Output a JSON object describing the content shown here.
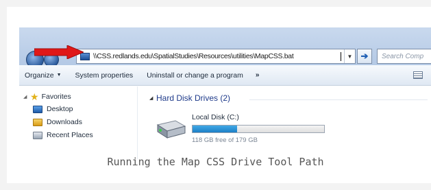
{
  "address_bar": {
    "path": "\\\\CSS.redlands.edu\\SpatialStudies\\Resources\\utilities\\MapCSS.bat",
    "dropdown_glyph": "▼",
    "go_glyph": "➔",
    "search_placeholder": "Search Comp"
  },
  "command_bar": {
    "items": [
      "Organize",
      "System properties",
      "Uninstall or change a program"
    ],
    "dropdown_glyph": "▼",
    "more": "»"
  },
  "nav_pane": {
    "favorites_label": "Favorites",
    "items": [
      "Desktop",
      "Downloads",
      "Recent Places"
    ]
  },
  "content": {
    "group_label": "Hard Disk Drives (2)",
    "drive": {
      "name": "Local Disk (C:)",
      "free_text": "118 GB free of 179 GB",
      "used_fraction": 0.34
    }
  },
  "caption": "Running the Map CSS Drive Tool Path",
  "colors": {
    "arrow": "#e01818",
    "bar_fill": "#1d7fc6",
    "group_text": "#1e3a8a"
  }
}
